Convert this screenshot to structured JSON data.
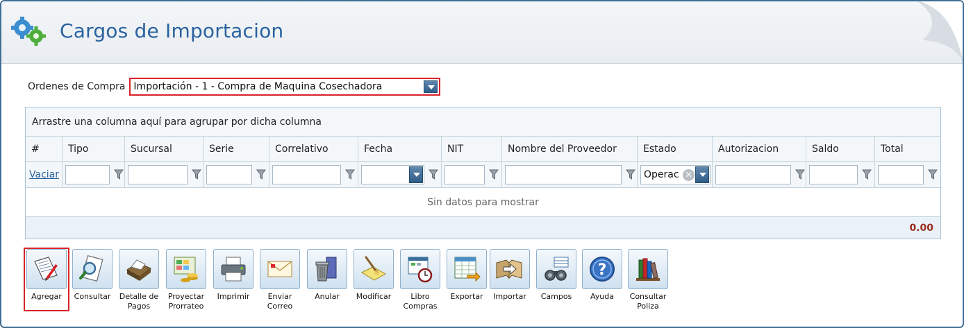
{
  "page": {
    "title": "Cargos de Importacion"
  },
  "filter": {
    "label": "Ordenes de Compra",
    "selected": "Importación - 1 - Compra de Maquina Cosechadora"
  },
  "grid": {
    "group_panel_text": "Arrastre una columna aquí para agrupar por dicha columna",
    "columns": [
      "#",
      "Tipo",
      "Sucursal",
      "Serie",
      "Correlativo",
      "Fecha",
      "NIT",
      "Nombre del Proveedor",
      "Estado",
      "Autorizacion",
      "Saldo",
      "Total"
    ],
    "filter_row": {
      "clear_link": "Vaciar",
      "estado_value": "Operac"
    },
    "empty_text": "Sin datos para mostrar",
    "footer_total": "0.00"
  },
  "toolbar": {
    "buttons": [
      {
        "label": "Agregar",
        "icon": "add-document-icon"
      },
      {
        "label": "Consultar",
        "icon": "search-document-icon"
      },
      {
        "label": "Detalle de\nPagos",
        "icon": "payments-icon"
      },
      {
        "label": "Proyectar\nProrrateo",
        "icon": "proration-icon"
      },
      {
        "label": "Imprimir",
        "icon": "printer-icon"
      },
      {
        "label": "Enviar\nCorreo",
        "icon": "mail-icon"
      },
      {
        "label": "Anular",
        "icon": "trash-icon"
      },
      {
        "label": "Modificar",
        "icon": "edit-icon"
      },
      {
        "label": "Libro\nCompras",
        "icon": "book-clock-icon"
      },
      {
        "label": "Exportar",
        "icon": "export-icon"
      },
      {
        "label": "Importar",
        "icon": "import-icon"
      },
      {
        "label": "Campos",
        "icon": "binoculars-icon"
      },
      {
        "label": "Ayuda",
        "icon": "help-icon"
      },
      {
        "label": "Consultar\nPoliza",
        "icon": "books-icon"
      }
    ]
  },
  "colors": {
    "accent": "#2a62a0",
    "highlight": "#d8232a",
    "total": "#9b2a20"
  }
}
